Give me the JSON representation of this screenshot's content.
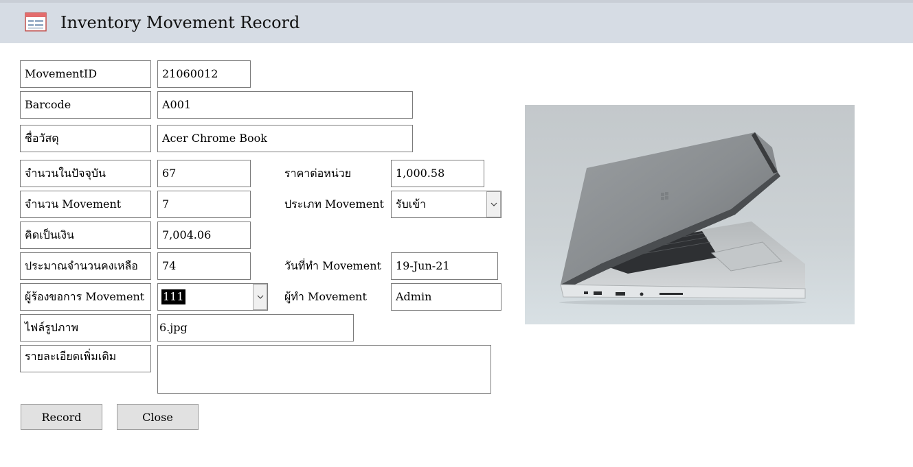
{
  "window": {
    "title": "Inventory Movement Record",
    "icon": "form-icon"
  },
  "form": {
    "movement_id": {
      "label": "MovementID",
      "value": "21060012"
    },
    "barcode": {
      "label": "Barcode",
      "value": "A001"
    },
    "material_name": {
      "label": "ชื่อวัสดุ",
      "value": "Acer Chrome Book"
    },
    "current_qty": {
      "label": "จำนวนในปัจจุบัน",
      "value": "67"
    },
    "unit_price": {
      "label": "ราคาต่อหน่วย",
      "value": "1,000.58"
    },
    "movement_qty": {
      "label": "จำนวน Movement",
      "value": "7"
    },
    "movement_type": {
      "label": "ประเภท Movement",
      "value": "รับเข้า"
    },
    "amount": {
      "label": "คิดเป็นเงิน",
      "value": "7,004.06"
    },
    "estimated_remaining": {
      "label": "ประมาณจำนวนคงเหลือ",
      "value": "74"
    },
    "movement_date": {
      "label": "วันที่ทำ Movement",
      "value": "19-Jun-21"
    },
    "requester": {
      "label": "ผู้ร้องขอการ Movement",
      "value": "111"
    },
    "operator": {
      "label": "ผู้ทำ Movement",
      "value": "Admin"
    },
    "image_file": {
      "label": "ไฟล์รูปภาพ",
      "value": "6.jpg"
    },
    "details": {
      "label": "รายละเอียดเพิ่มเติม",
      "value": ""
    }
  },
  "buttons": {
    "record": "Record",
    "close": "Close"
  },
  "image": {
    "subject": "laptop-photo"
  }
}
